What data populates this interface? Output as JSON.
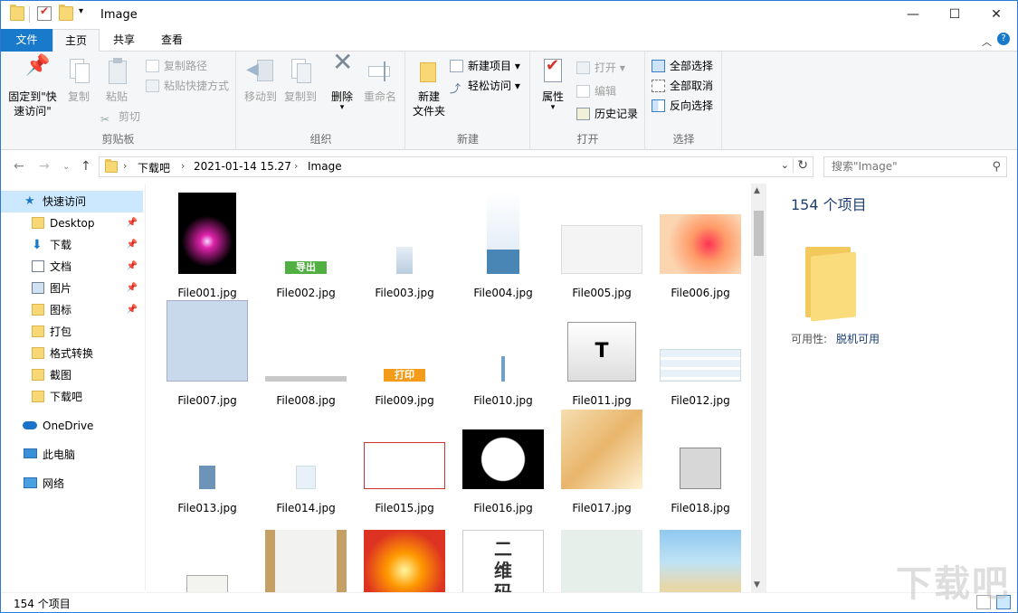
{
  "window": {
    "title": "Image",
    "minimize": "—",
    "maximize": "☐",
    "close": "✕"
  },
  "ribbon_tabs": [
    {
      "label": "文件"
    },
    {
      "label": "主页"
    },
    {
      "label": "共享"
    },
    {
      "label": "查看"
    }
  ],
  "ribbon": {
    "clipboard": {
      "label": "剪贴板",
      "pin": "固定到\"快\n速访问\"",
      "copy": "复制",
      "paste": "粘贴",
      "copy_path": "复制路径",
      "paste_shortcut": "粘贴快捷方式",
      "cut": "剪切"
    },
    "organize": {
      "label": "组织",
      "move_to": "移动到",
      "copy_to": "复制到",
      "delete": "删除",
      "rename": "重命名"
    },
    "new": {
      "label": "新建",
      "new_folder": "新建\n文件夹",
      "new_item": "新建项目",
      "easy_access": "轻松访问"
    },
    "open": {
      "label": "打开",
      "properties": "属性",
      "open": "打开",
      "edit": "编辑",
      "history": "历史记录"
    },
    "select": {
      "label": "选择",
      "select_all": "全部选择",
      "select_none": "全部取消",
      "invert": "反向选择"
    }
  },
  "address": {
    "crumbs": [
      "下载吧",
      "2021-01-14 15.27",
      "Image"
    ],
    "search_placeholder": "搜索\"Image\""
  },
  "nav_pane": {
    "quick_access": "快速访问",
    "items": [
      {
        "label": "Desktop",
        "pinned": true,
        "icon": "folder-icon"
      },
      {
        "label": "下载",
        "pinned": true,
        "icon": "download-icon"
      },
      {
        "label": "文档",
        "pinned": true,
        "icon": "document-icon"
      },
      {
        "label": "图片",
        "pinned": true,
        "icon": "pictures-icon"
      },
      {
        "label": "图标",
        "pinned": true,
        "icon": "folder-icon"
      },
      {
        "label": "打包",
        "pinned": false,
        "icon": "folder-icon"
      },
      {
        "label": "格式转换",
        "pinned": false,
        "icon": "folder-icon"
      },
      {
        "label": "截图",
        "pinned": false,
        "icon": "folder-icon"
      },
      {
        "label": "下载吧",
        "pinned": false,
        "icon": "folder-icon"
      }
    ],
    "onedrive": "OneDrive",
    "this_pc": "此电脑",
    "network": "网络"
  },
  "files": [
    {
      "name": "File001.jpg"
    },
    {
      "name": "File002.jpg",
      "text": "导出"
    },
    {
      "name": "File003.jpg"
    },
    {
      "name": "File004.jpg"
    },
    {
      "name": "File005.jpg"
    },
    {
      "name": "File006.jpg"
    },
    {
      "name": "File007.jpg"
    },
    {
      "name": "File008.jpg"
    },
    {
      "name": "File009.jpg",
      "text": "打印"
    },
    {
      "name": "File010.jpg"
    },
    {
      "name": "File011.jpg",
      "text": "T"
    },
    {
      "name": "File012.jpg"
    },
    {
      "name": "File013.jpg"
    },
    {
      "name": "File014.jpg"
    },
    {
      "name": "File015.jpg"
    },
    {
      "name": "File016.jpg"
    },
    {
      "name": "File017.jpg"
    },
    {
      "name": "File018.jpg"
    },
    {
      "name": ""
    },
    {
      "name": ""
    },
    {
      "name": ""
    },
    {
      "name": "",
      "text": "二\n维\n码"
    },
    {
      "name": ""
    },
    {
      "name": ""
    }
  ],
  "details": {
    "count": "154 个项目",
    "availability_label": "可用性:",
    "availability_value": "脱机可用"
  },
  "status": {
    "count": "154 个项目"
  },
  "watermark": "下载吧",
  "colors": {
    "accent": "#1979ca",
    "folder": "#f8d775"
  }
}
